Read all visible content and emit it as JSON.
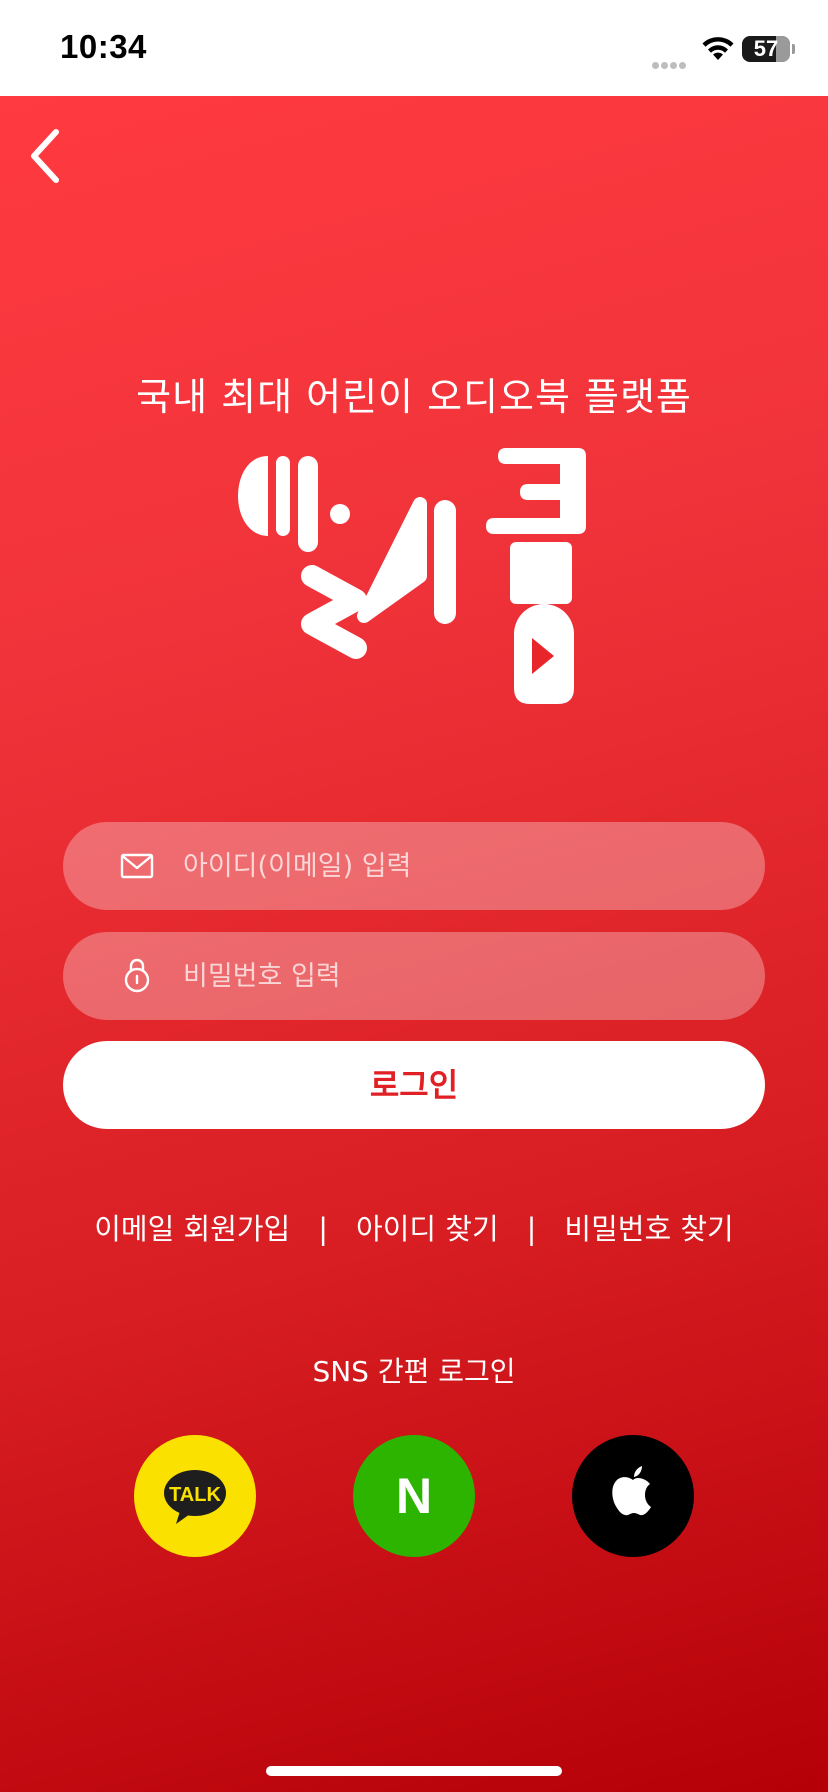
{
  "status_bar": {
    "time": "10:34",
    "battery": "57"
  },
  "header": {
    "back_icon": "chevron-left-icon"
  },
  "main": {
    "tagline": "국내 최대 어린이 오디오북 플랫폼",
    "logo_icon": "app-logo"
  },
  "login_form": {
    "email_placeholder": "아이디(이메일) 입력",
    "email_icon": "envelope-icon",
    "password_placeholder": "비밀번호 입력",
    "password_icon": "lock-icon",
    "login_label": "로그인"
  },
  "links": {
    "signup": "이메일 회원가입",
    "find_id": "아이디 찾기",
    "find_password": "비밀번호 찾기",
    "separator": "|"
  },
  "sns": {
    "label": "SNS 간편 로그인",
    "kakao": {
      "icon": "kakaotalk-icon",
      "text": "TALK",
      "color": "#fae100"
    },
    "naver": {
      "icon": "naver-icon",
      "text": "N",
      "color": "#2db400"
    },
    "apple": {
      "icon": "apple-icon",
      "color": "#000000"
    }
  },
  "colors": {
    "brand_red": "#e02025",
    "gradient_top": "#ff3a40",
    "gradient_bottom": "#b50008"
  }
}
